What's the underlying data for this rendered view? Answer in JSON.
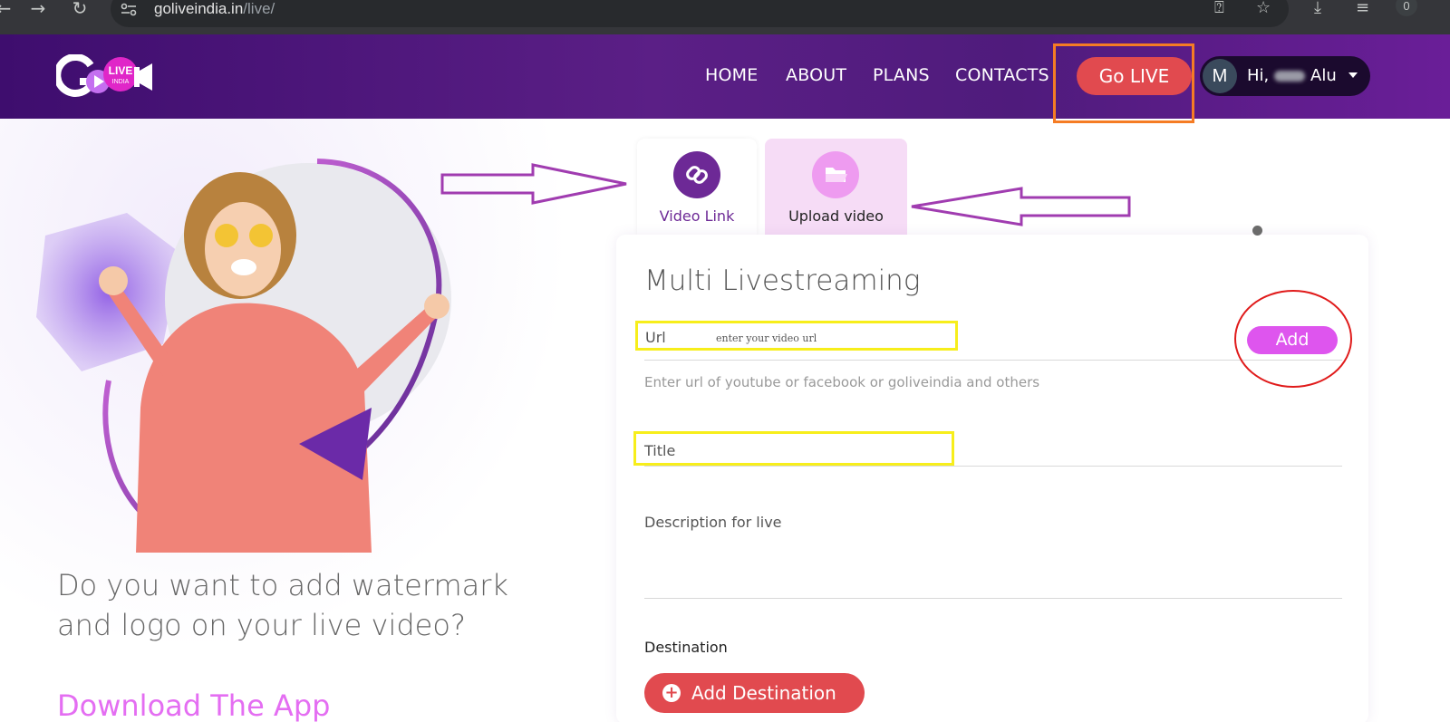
{
  "browser": {
    "url_host": "goliveindia.in",
    "url_path": "/live/",
    "back_icon": "arrow-left-icon",
    "forward_icon": "arrow-right-icon",
    "reload_icon": "reload-icon",
    "extension_count": "0"
  },
  "header": {
    "logo_text": "LIVE INDIA",
    "nav": [
      "HOME",
      "ABOUT",
      "PLANS",
      "CONTACTS"
    ],
    "golive_label": "Go LIVE",
    "user_initial": "M",
    "user_greeting": "Hi,",
    "user_name": "Alu"
  },
  "hero": {
    "question": "Do you want to add watermark and logo on your live video?",
    "download_label": "Download The App"
  },
  "tabs": [
    {
      "label": "Video Link",
      "icon": "link-icon",
      "active": true
    },
    {
      "label": "Upload video",
      "icon": "folder-icon",
      "active": false
    }
  ],
  "form": {
    "title": "Multi Livestreaming",
    "url_label": "Url",
    "url_placeholder": "enter your video url",
    "url_helper": "Enter url of youtube or facebook or goliveindia and others",
    "add_label": "Add",
    "title_label": "Title",
    "description_label": "Description for live",
    "destination_label": "Destination",
    "add_destination_label": "Add Destination"
  },
  "annotation_colors": {
    "orange_box": "#f57c24",
    "yellow_box": "#f7ee1b",
    "red_circle": "#e01b1b",
    "purple_arrow": "#a03cb0"
  },
  "colors": {
    "header_start": "#3e0d6e",
    "accent_red": "#e14a4f",
    "accent_pink": "#de55ee",
    "tab_active": "#6d2996"
  }
}
